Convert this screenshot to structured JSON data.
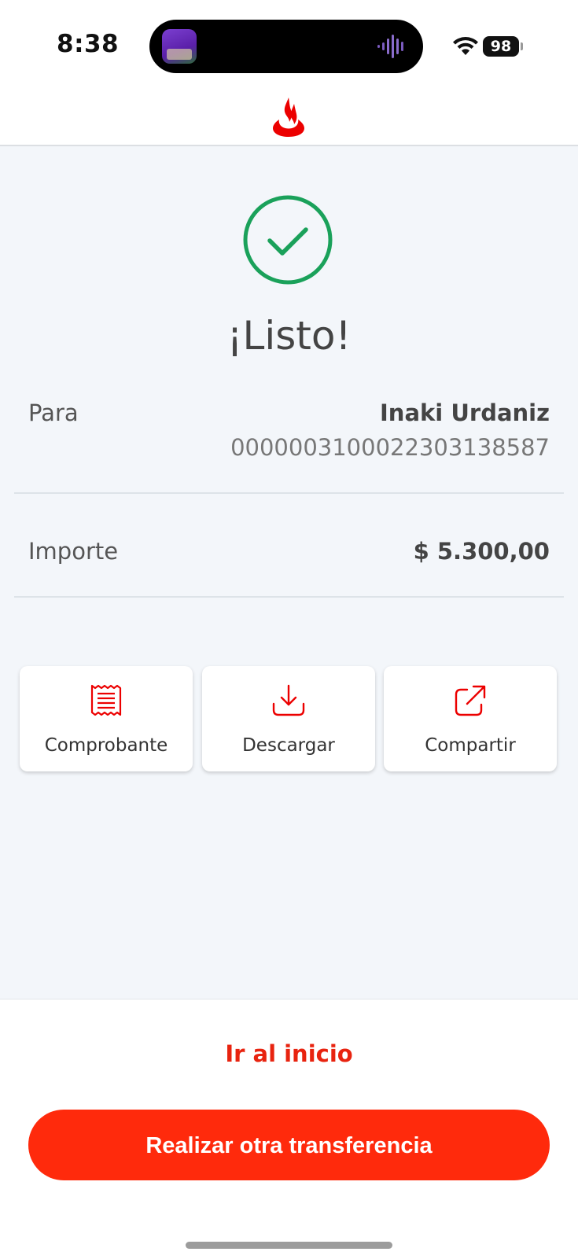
{
  "status_bar": {
    "time": "8:38",
    "battery": "98"
  },
  "header": {
    "logo_icon": "santander-flame-icon",
    "brand_color": "#EC0000"
  },
  "result": {
    "icon": "check-circle-icon",
    "icon_color": "#1aa15a",
    "title": "¡Listo!"
  },
  "details": {
    "to": {
      "label": "Para",
      "name": "Inaki Urdaniz",
      "account": "0000003100022303138587"
    },
    "amount": {
      "label": "Importe",
      "value": "$ 5.300,00"
    }
  },
  "actions": [
    {
      "label": "Comprobante",
      "icon": "receipt-icon"
    },
    {
      "label": "Descargar",
      "icon": "download-icon"
    },
    {
      "label": "Compartir",
      "icon": "share-icon"
    }
  ],
  "footer": {
    "home_link": "Ir al inicio",
    "primary_button": "Realizar otra transferencia",
    "accent_color": "#ff2a0c"
  }
}
